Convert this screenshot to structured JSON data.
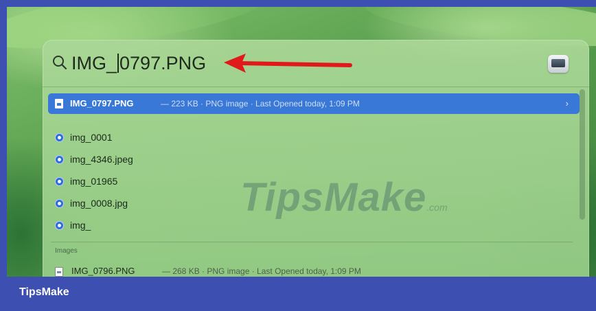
{
  "spotlight": {
    "query_before_caret": "IMG_",
    "query_after_caret": "0797.PNG",
    "top_hit": {
      "name": "IMG_0797.PNG",
      "meta": "— 223 KB · PNG image · Last Opened today, 1:09 PM",
      "chevron": "›"
    },
    "results": [
      {
        "label": "img_0001"
      },
      {
        "label": "img_4346.jpeg"
      },
      {
        "label": "img_01965"
      },
      {
        "label": "img_0008.jpg"
      },
      {
        "label": "img_"
      }
    ],
    "section_label": "Images",
    "image_row": {
      "name": "IMG_0796.PNG",
      "meta": "— 268 KB · PNG image · Last Opened today, 1:09 PM"
    }
  },
  "watermark": {
    "main": "TipsMake",
    "suffix": ".com"
  },
  "footer": {
    "brand": "TipsMake"
  },
  "colors": {
    "selection": "#3a78d8",
    "arrow": "#e01a1a",
    "frame": "#3d4fb0"
  },
  "icons": [
    "search-icon",
    "document-icon",
    "chevron-right-icon",
    "search-result-icon",
    "image-file-icon",
    "preview-app-icon",
    "red-arrow-icon"
  ]
}
